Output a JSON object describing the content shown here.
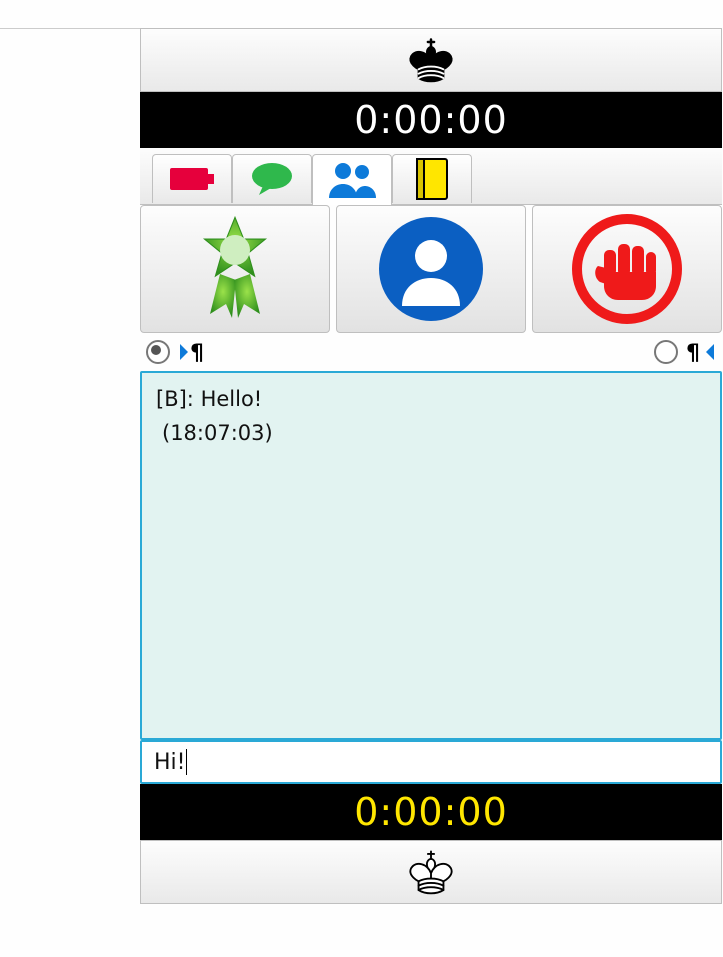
{
  "players": {
    "top": {
      "piece": "king",
      "color": "black"
    },
    "bottom": {
      "piece": "king",
      "color": "white"
    }
  },
  "clocks": {
    "top": "0:00:00",
    "bottom": "0:00:00"
  },
  "tabs": [
    {
      "id": "engine",
      "icon": "battery"
    },
    {
      "id": "chat",
      "icon": "speech"
    },
    {
      "id": "people",
      "icon": "people",
      "active": true
    },
    {
      "id": "book",
      "icon": "book"
    }
  ],
  "actions": [
    {
      "id": "award",
      "icon": "ribbon"
    },
    {
      "id": "profile",
      "icon": "avatar"
    },
    {
      "id": "abort",
      "icon": "fist"
    }
  ],
  "direction_controls": {
    "left": {
      "checked": true,
      "icon": "pilcrow-right"
    },
    "right": {
      "checked": false,
      "icon": "pilcrow-left"
    }
  },
  "chat": {
    "messages": [
      {
        "sender": "[B]",
        "text": "Hello!",
        "time": "(18:07:03)"
      }
    ],
    "input": "Hi!"
  }
}
